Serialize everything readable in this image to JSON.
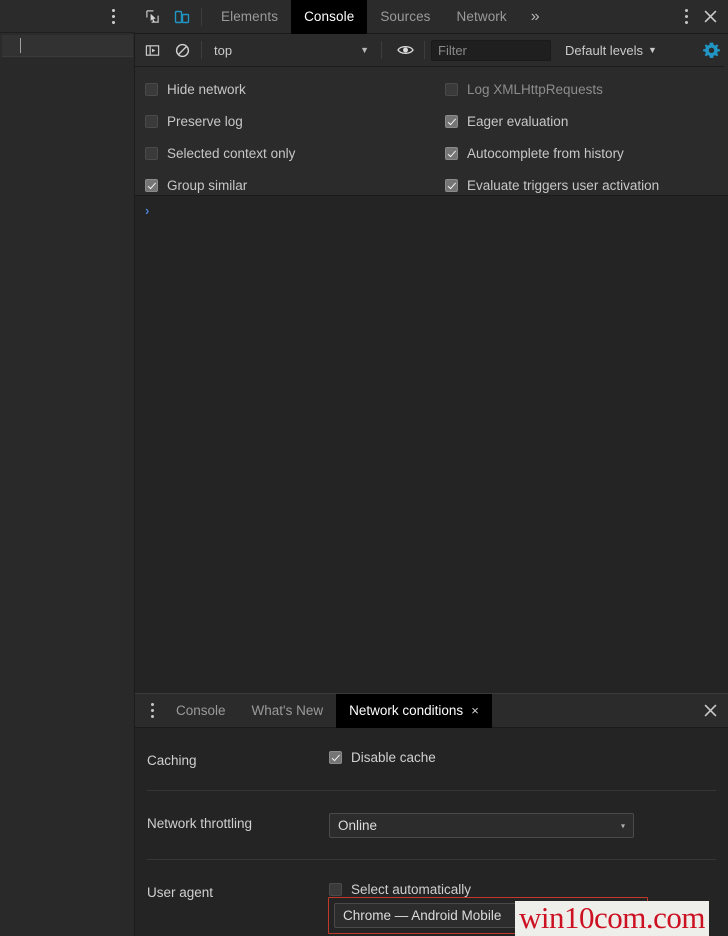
{
  "browser": {
    "kebab_icon": "kebab-menu-icon",
    "address_bar_value": ""
  },
  "devtools": {
    "toolbar": {
      "inspect_icon": "inspect-element-icon",
      "device_toggle_icon": "device-toolbar-icon",
      "device_toggle_active_color": "#4a9ad4",
      "more_icon": "kebab-menu-icon",
      "close_icon": "close-icon"
    },
    "tabs": [
      {
        "label": "Elements",
        "active": false
      },
      {
        "label": "Console",
        "active": true
      },
      {
        "label": "Sources",
        "active": false
      },
      {
        "label": "Network",
        "active": false
      }
    ],
    "tabs_overflow_label": "»",
    "console_toolbar": {
      "sidebar_toggle_icon": "console-sidebar-icon",
      "clear_icon": "clear-console-icon",
      "context_selected": "top",
      "context_caret": "▼",
      "eye_icon": "live-expression-eye-icon",
      "filter_placeholder": "Filter",
      "filter_value": "",
      "levels_label": "Default levels",
      "levels_caret": "▼",
      "settings_gear_icon": "gear-icon",
      "settings_gear_color": "#2196c4"
    },
    "settings": {
      "left_column": [
        {
          "label": "Hide network",
          "checked": false,
          "dim": false
        },
        {
          "label": "Preserve log",
          "checked": false,
          "dim": false
        },
        {
          "label": "Selected context only",
          "checked": false,
          "dim": false
        },
        {
          "label": "Group similar",
          "checked": true,
          "dim": false
        }
      ],
      "right_column": [
        {
          "label": "Log XMLHttpRequests",
          "checked": false,
          "dim": true
        },
        {
          "label": "Eager evaluation",
          "checked": true,
          "dim": false
        },
        {
          "label": "Autocomplete from history",
          "checked": true,
          "dim": false
        },
        {
          "label": "Evaluate triggers user activation",
          "checked": true,
          "dim": false
        }
      ]
    },
    "console": {
      "prompt_chevron": "›",
      "prompt_value": ""
    },
    "drawer": {
      "more_icon": "kebab-menu-icon",
      "close_icon": "close-icon",
      "tabs": [
        {
          "label": "Console",
          "active": false,
          "closable": false
        },
        {
          "label": "What's New",
          "active": false,
          "closable": false
        },
        {
          "label": "Network conditions",
          "active": true,
          "closable": true,
          "close_glyph": "×"
        }
      ],
      "network_conditions": {
        "caching": {
          "label": "Caching",
          "disable_cache_label": "Disable cache",
          "disable_cache_checked": true
        },
        "throttling": {
          "label": "Network throttling",
          "selected": "Online",
          "caret": "▾"
        },
        "user_agent": {
          "label": "User agent",
          "select_automatically_label": "Select automatically",
          "select_automatically_checked": false,
          "selected": "Chrome — Android Mobile",
          "highlight_color": "#c0392b"
        }
      }
    }
  },
  "watermark": {
    "text": "win10com.com",
    "color": "#cc1122"
  }
}
